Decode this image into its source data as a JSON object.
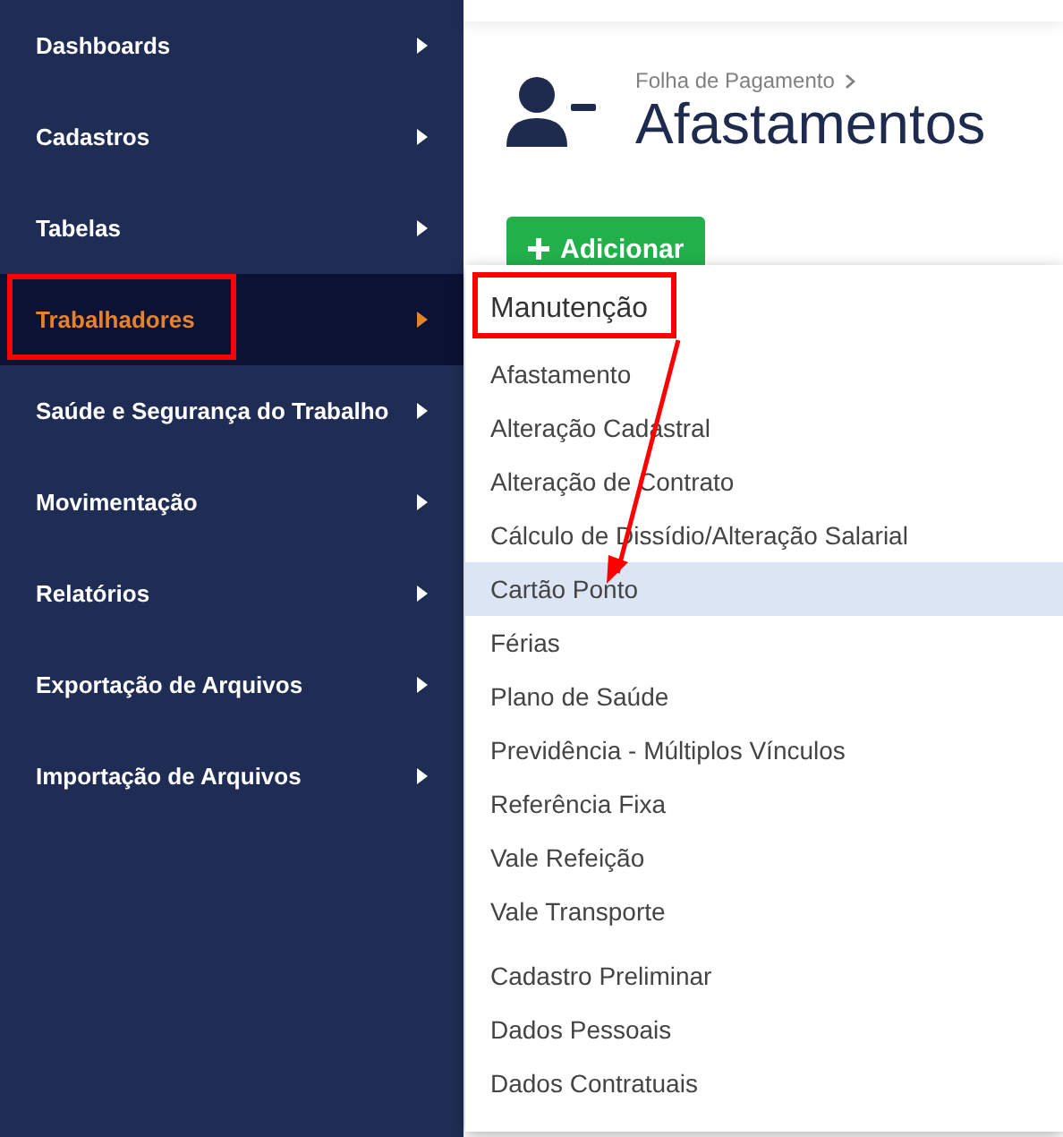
{
  "sidebar": {
    "items": [
      {
        "label": "Dashboards",
        "selected": false,
        "annotated": false
      },
      {
        "label": "Cadastros",
        "selected": false,
        "annotated": false
      },
      {
        "label": "Tabelas",
        "selected": false,
        "annotated": false
      },
      {
        "label": "Trabalhadores",
        "selected": true,
        "annotated": true
      },
      {
        "label": "Saúde e Segurança do Trabalho",
        "selected": false,
        "annotated": false
      },
      {
        "label": "Movimentação",
        "selected": false,
        "annotated": false
      },
      {
        "label": "Relatórios",
        "selected": false,
        "annotated": false
      },
      {
        "label": "Exportação de Arquivos",
        "selected": false,
        "annotated": false
      },
      {
        "label": "Importação de Arquivos",
        "selected": false,
        "annotated": false
      }
    ]
  },
  "header": {
    "breadcrumb": "Folha de Pagamento",
    "title": "Afastamentos"
  },
  "add_button": {
    "label": "Adicionar"
  },
  "submenu": {
    "sections": [
      {
        "title": "Manutenção",
        "annotated": true,
        "items": [
          {
            "label": "Afastamento",
            "selected": false
          },
          {
            "label": "Alteração Cadastral",
            "selected": false
          },
          {
            "label": "Alteração de Contrato",
            "selected": false
          },
          {
            "label": "Cálculo de Dissídio/Alteração Salarial",
            "selected": false
          },
          {
            "label": "Cartão Ponto",
            "selected": true
          },
          {
            "label": "Férias",
            "selected": false
          },
          {
            "label": "Plano de Saúde",
            "selected": false
          },
          {
            "label": "Previdência - Múltiplos Vínculos",
            "selected": false
          },
          {
            "label": "Referência Fixa",
            "selected": false
          },
          {
            "label": "Vale Refeição",
            "selected": false
          },
          {
            "label": "Vale Transporte",
            "selected": false
          }
        ]
      },
      {
        "items": [
          {
            "label": "Cadastro Preliminar",
            "selected": false
          },
          {
            "label": "Dados Pessoais",
            "selected": false
          },
          {
            "label": "Dados Contratuais",
            "selected": false
          }
        ]
      }
    ]
  },
  "annotation_arrow": true
}
